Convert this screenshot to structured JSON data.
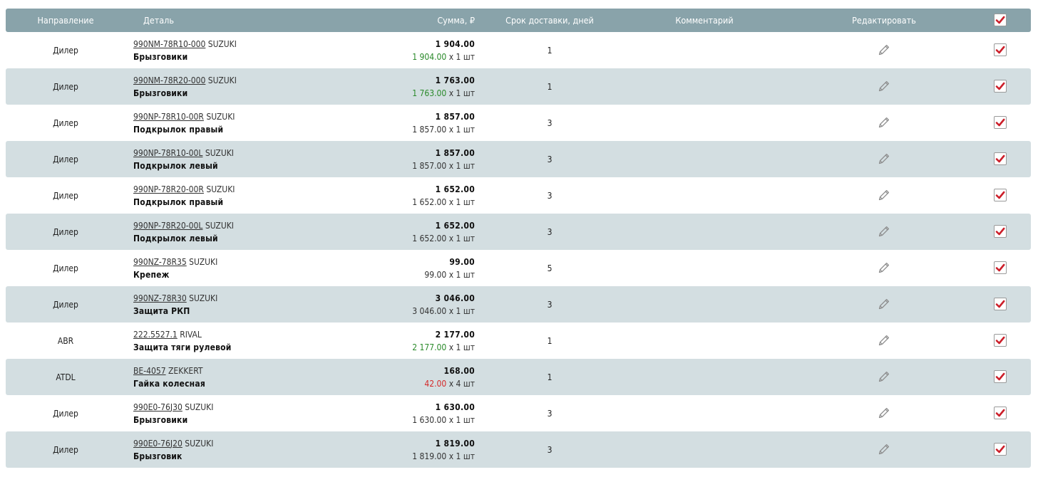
{
  "header": {
    "direction": "Направление",
    "part": "Деталь",
    "sum": "Сумма, ₽",
    "delivery": "Срок доставки, дней",
    "comment": "Комментарий",
    "edit": "Редактировать"
  },
  "colors": {
    "header_bg": "#89a3aa",
    "row_shaded": "#d3dee1",
    "check_mark": "#cc1f2a",
    "price_green": "#2a8a2a",
    "price_red": "#d42a2a"
  },
  "rows": [
    {
      "direction": "Дилер",
      "article": "990NM-78R10-000",
      "brand": "SUZUKI",
      "name": "Брызговики",
      "total": "1 904.00",
      "unit_price": "1 904.00",
      "unit_color": "green",
      "qty": " x 1 шт",
      "days": "1",
      "comment": "",
      "checked": true
    },
    {
      "direction": "Дилер",
      "article": "990NM-78R20-000",
      "brand": "SUZUKI",
      "name": "Брызговики",
      "total": "1 763.00",
      "unit_price": "1 763.00",
      "unit_color": "green",
      "qty": " x 1 шт",
      "days": "1",
      "comment": "",
      "checked": true
    },
    {
      "direction": "Дилер",
      "article": "990NP-78R10-00R",
      "brand": "SUZUKI",
      "name": "Подкрылок правый",
      "total": "1 857.00",
      "unit_price": "1 857.00",
      "unit_color": "normal",
      "qty": " x 1 шт",
      "days": "3",
      "comment": "",
      "checked": true
    },
    {
      "direction": "Дилер",
      "article": "990NP-78R10-00L",
      "brand": "SUZUKI",
      "name": "Подкрылок левый",
      "total": "1 857.00",
      "unit_price": "1 857.00",
      "unit_color": "normal",
      "qty": " x 1 шт",
      "days": "3",
      "comment": "",
      "checked": true
    },
    {
      "direction": "Дилер",
      "article": "990NP-78R20-00R",
      "brand": "SUZUKI",
      "name": "Подкрылок правый",
      "total": "1 652.00",
      "unit_price": "1 652.00",
      "unit_color": "normal",
      "qty": " x 1 шт",
      "days": "3",
      "comment": "",
      "checked": true
    },
    {
      "direction": "Дилер",
      "article": "990NP-78R20-00L",
      "brand": "SUZUKI",
      "name": "Подкрылок левый",
      "total": "1 652.00",
      "unit_price": "1 652.00",
      "unit_color": "normal",
      "qty": " x 1 шт",
      "days": "3",
      "comment": "",
      "checked": true
    },
    {
      "direction": "Дилер",
      "article": "990NZ-78R35",
      "brand": "SUZUKI",
      "name": "Крепеж",
      "total": "99.00",
      "unit_price": "99.00",
      "unit_color": "normal",
      "qty": " x 1 шт",
      "days": "5",
      "comment": "",
      "checked": true
    },
    {
      "direction": "Дилер",
      "article": "990NZ-78R30",
      "brand": "SUZUKI",
      "name": "Защита РКП",
      "total": "3 046.00",
      "unit_price": "3 046.00",
      "unit_color": "normal",
      "qty": " x 1 шт",
      "days": "3",
      "comment": "",
      "checked": true
    },
    {
      "direction": "ABR",
      "article": "222.5527.1",
      "brand": "RIVAL",
      "name": "Защита тяги рулевой",
      "total": "2 177.00",
      "unit_price": "2 177.00",
      "unit_color": "green",
      "qty": " x 1 шт",
      "days": "1",
      "comment": "",
      "checked": true
    },
    {
      "direction": "ATDL",
      "article": "BE-4057",
      "brand": "ZEKKERT",
      "name": "Гайка колесная",
      "total": "168.00",
      "unit_price": "42.00",
      "unit_color": "red",
      "qty": " x 4 шт",
      "days": "1",
      "comment": "",
      "checked": true
    },
    {
      "direction": "Дилер",
      "article": "990E0-76J30",
      "brand": "SUZUKI",
      "name": "Брызговики",
      "total": "1 630.00",
      "unit_price": "1 630.00",
      "unit_color": "normal",
      "qty": " x 1 шт",
      "days": "3",
      "comment": "",
      "checked": true
    },
    {
      "direction": "Дилер",
      "article": "990E0-76J20",
      "brand": "SUZUKI",
      "name": "Брызговик",
      "total": "1 819.00",
      "unit_price": "1 819.00",
      "unit_color": "normal",
      "qty": " x 1 шт",
      "days": "3",
      "comment": "",
      "checked": true
    }
  ]
}
